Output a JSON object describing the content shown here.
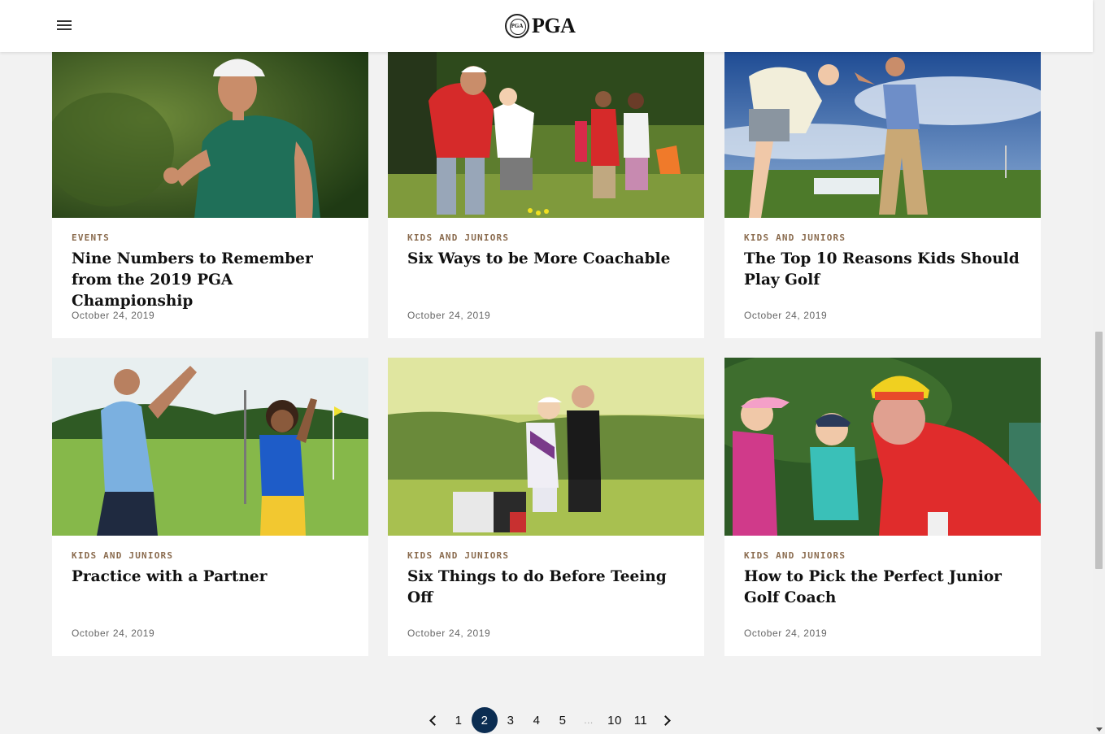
{
  "header": {
    "logo_text": "PGA",
    "seal_text": "PGA"
  },
  "articles": [
    {
      "category": "EVENTS",
      "title": "Nine Numbers to Remember from the 2019 PGA Championship",
      "date": "October 24, 2019"
    },
    {
      "category": "KIDS AND JUNIORS",
      "title": "Six Ways to be More Coachable",
      "date": "October 24, 2019"
    },
    {
      "category": "KIDS AND JUNIORS",
      "title": "The Top 10 Reasons Kids Should Play Golf",
      "date": "October 24, 2019"
    },
    {
      "category": "KIDS AND JUNIORS",
      "title": "Practice with a Partner",
      "date": "October 24, 2019"
    },
    {
      "category": "KIDS AND JUNIORS",
      "title": "Six Things to do Before Teeing Off",
      "date": "October 24, 2019"
    },
    {
      "category": "KIDS AND JUNIORS",
      "title": "How to Pick the Perfect Junior Golf Coach",
      "date": "October 24, 2019"
    }
  ],
  "pagination": {
    "pages": [
      "1",
      "2",
      "3",
      "4",
      "5",
      "...",
      "10",
      "11"
    ],
    "current": "2"
  },
  "colors": {
    "accent": "#0b2d52",
    "category": "#8a6b4e",
    "background": "#f2f2f2"
  }
}
